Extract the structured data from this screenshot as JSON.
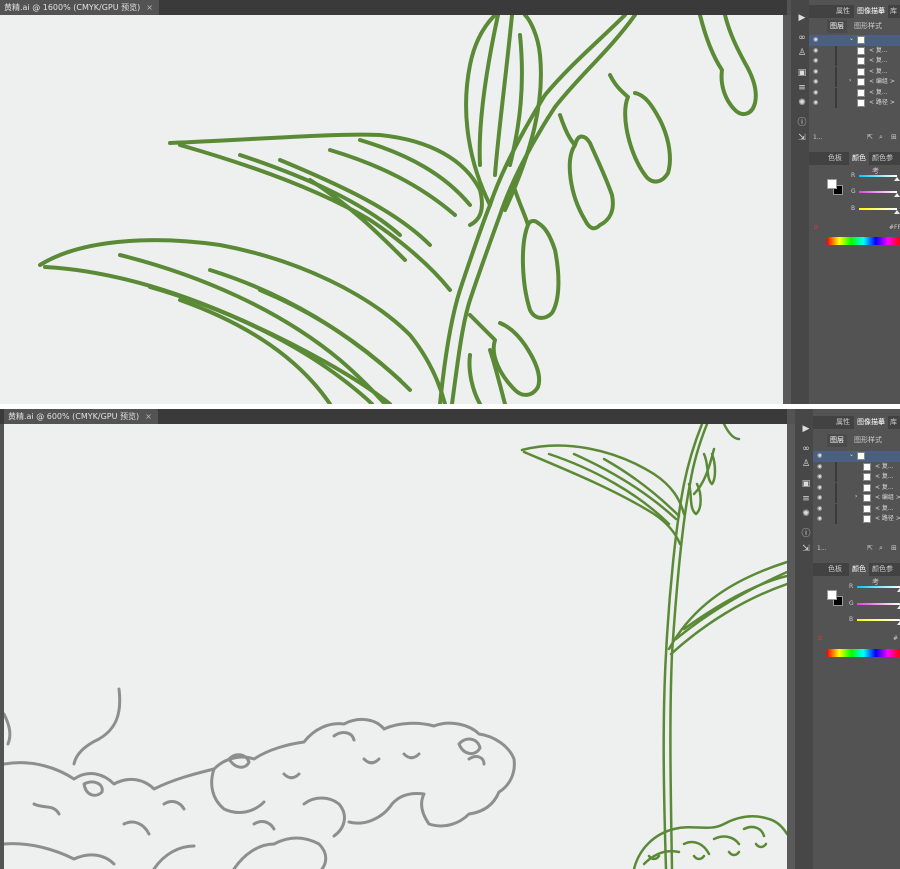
{
  "windows": [
    {
      "id": "top",
      "doc_tab": {
        "title": "黄精.ai @ 1600% (CMYK/GPU 预览)",
        "close": "×"
      },
      "panel": {
        "tabs": [
          "属性",
          "图像描摹",
          "库"
        ],
        "active_tab": 1,
        "subtabs": [
          "图层",
          "图形样式"
        ],
        "active_subtab": 0,
        "layers": [
          {
            "label": "",
            "selected": true,
            "arrow": "⌄"
          },
          {
            "label": "< 复...",
            "selected": false,
            "arrow": ""
          },
          {
            "label": "< 复...",
            "selected": false,
            "arrow": ""
          },
          {
            "label": "< 复...",
            "selected": false,
            "arrow": ""
          },
          {
            "label": "< 编组 >",
            "selected": false,
            "arrow": "›"
          },
          {
            "label": "< 复...",
            "selected": false,
            "arrow": ""
          },
          {
            "label": "< 路径 >",
            "selected": false,
            "arrow": ""
          }
        ],
        "layer_count": "1...",
        "color_tabs": [
          "色板",
          "颜色",
          "颜色参考"
        ],
        "active_color_tab": 1,
        "channels": [
          {
            "name": "R",
            "gradient": "linear-gradient(90deg,#00c8ff,#ffffff)",
            "level": 0.99
          },
          {
            "name": "G",
            "gradient": "linear-gradient(90deg,#e040e0,#ffffff)",
            "level": 0.99
          },
          {
            "name": "B",
            "gradient": "linear-gradient(90deg,#ffff00,#ffffff)",
            "level": 0.99
          }
        ],
        "hex_prefix": "#",
        "hex_value": "FF"
      }
    },
    {
      "id": "bottom",
      "doc_tab": {
        "title": "黄精.ai @ 600% (CMYK/GPU 预览)",
        "close": "×"
      },
      "panel": {
        "tabs": [
          "属性",
          "图像描摹",
          "库"
        ],
        "active_tab": 1,
        "subtabs": [
          "图层",
          "图形样式"
        ],
        "active_subtab": 0,
        "layers": [
          {
            "label": "",
            "selected": true,
            "arrow": "⌄"
          },
          {
            "label": "< 复...",
            "selected": false,
            "arrow": ""
          },
          {
            "label": "< 复...",
            "selected": false,
            "arrow": ""
          },
          {
            "label": "< 复...",
            "selected": false,
            "arrow": ""
          },
          {
            "label": "< 编组 >",
            "selected": false,
            "arrow": "›"
          },
          {
            "label": "< 复...",
            "selected": false,
            "arrow": ""
          },
          {
            "label": "< 路径 >",
            "selected": false,
            "arrow": ""
          }
        ],
        "layer_count": "1...",
        "color_tabs": [
          "色板",
          "颜色",
          "颜色参考"
        ],
        "active_color_tab": 1,
        "channels": [
          {
            "name": "R",
            "gradient": "linear-gradient(90deg,#00c8ff,#ffffff)",
            "level": 0.99
          },
          {
            "name": "G",
            "gradient": "linear-gradient(90deg,#e040e0,#ffffff)",
            "level": 0.99
          },
          {
            "name": "B",
            "gradient": "linear-gradient(90deg,#ffff00,#ffffff)",
            "level": 0.99
          }
        ],
        "hex_prefix": "#",
        "hex_value": ""
      }
    }
  ],
  "tools": [
    "play-icon",
    "link-icon",
    "puppet-icon",
    "layers-icon",
    "align-icon",
    "sun-icon",
    "info-icon",
    "export-icon"
  ],
  "colors": {
    "plant_green": "#5b8a37",
    "root_gray": "#8e8e8e",
    "canvas_bg": "#eef0ef",
    "chrome": "#535353",
    "selected_layer": "#4b5f80"
  }
}
